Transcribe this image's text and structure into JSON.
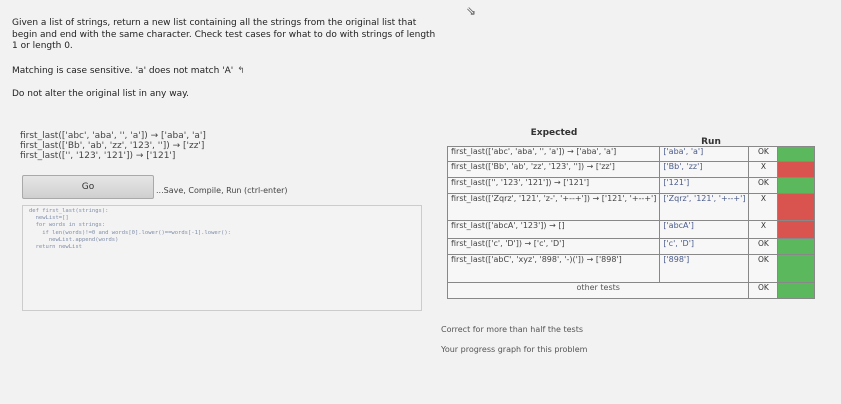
{
  "problem": {
    "description": "Given a list of strings, return a new list containing all the strings from the original list that begin and end with the same character. Check test cases for what to do with strings of length 1 or length 0.",
    "case_note": "Matching is case sensitive. 'a' does not match 'A'",
    "alter_note": "Do not alter the original list in any way."
  },
  "examples": [
    "first_last(['abc', 'aba', '', 'a']) → ['aba', 'a']",
    "first_last(['Bb', 'ab', 'zz', '123', '']) → ['zz']",
    "first_last(['', '123', '121']) → ['121']"
  ],
  "go_label": "Go",
  "save_hint": "...Save, Compile, Run (ctrl-enter)",
  "code": "def first_last(strings):\n  newList=[]\n  for words in strings:\n    if len(words)!=0 and words[0].lower()==words[-1].lower():\n      newList.append(words)\n  return newList",
  "table": {
    "expected_header": "Expected",
    "run_header": "Run",
    "rows": [
      {
        "expected": "first_last(['abc', 'aba', '', 'a']) → ['aba', 'a']",
        "run": "['aba', 'a']",
        "status": "OK"
      },
      {
        "expected": "first_last(['Bb', 'ab', 'zz', '123', '']) → ['zz']",
        "run": "['Bb', 'zz']",
        "status": "X"
      },
      {
        "expected": "first_last(['', '123', '121']) → ['121']",
        "run": "['121']",
        "status": "OK"
      },
      {
        "expected": "first_last(['Zqrz', '121', 'z-', '+--+']) → ['121', '+--+']",
        "run": "['Zqrz', '121', '+--+']",
        "status": "X"
      },
      {
        "expected": "first_last(['abcA', '123']) → []",
        "run": "['abcA']",
        "status": "X"
      },
      {
        "expected": "first_last(['c', 'D']) → ['c', 'D']",
        "run": "['c', 'D']",
        "status": "OK"
      },
      {
        "expected": "first_last(['abC', 'xyz', '898', '-)(']) → ['898']",
        "run": "['898']",
        "status": "OK"
      }
    ],
    "other_tests_label": "other tests",
    "other_tests_status": "OK"
  },
  "footer": {
    "correct_note": "Correct for more than half the tests",
    "progress_note": "Your progress graph for this problem"
  },
  "colors": {
    "ok": "#5cb85c",
    "fail": "#d9534f"
  }
}
